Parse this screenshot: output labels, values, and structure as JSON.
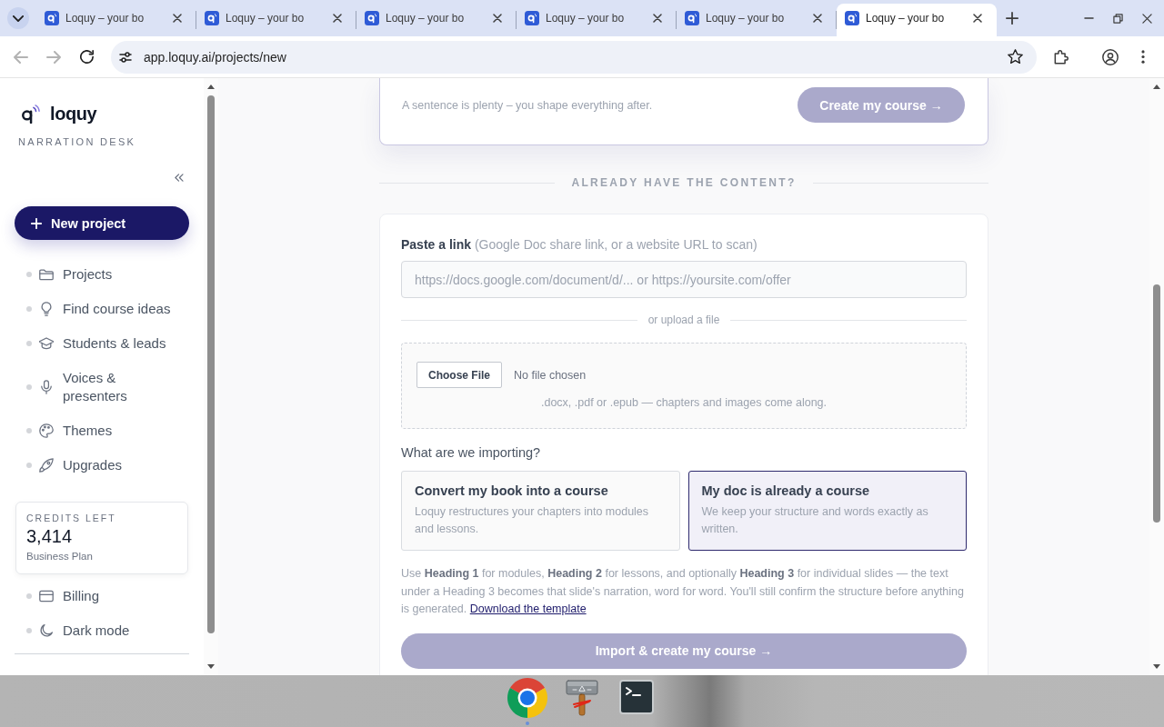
{
  "browser": {
    "tabs": [
      {
        "title": "Loquy – your bo",
        "selected": false
      },
      {
        "title": "Loquy – your bo",
        "selected": false
      },
      {
        "title": "Loquy – your bo",
        "selected": false
      },
      {
        "title": "Loquy – your bo",
        "selected": false
      },
      {
        "title": "Loquy – your bo",
        "selected": false
      },
      {
        "title": "Loquy – your bo",
        "selected": true
      }
    ],
    "back": {
      "disabled": true
    },
    "forward": {
      "disabled": true
    },
    "url": "app.loquy.ai/projects/new"
  },
  "sidebar": {
    "brand": "loquy",
    "tagline": "NARRATION DESK",
    "new_project": "New project",
    "nav": [
      {
        "label": "Projects"
      },
      {
        "label": "Find course ideas"
      },
      {
        "label": "Students & leads"
      },
      {
        "label": "Voices & presenters"
      },
      {
        "label": "Themes"
      },
      {
        "label": "Upgrades"
      }
    ],
    "credits": {
      "label": "CREDITS LEFT",
      "value": "3,414",
      "plan": "Business Plan"
    },
    "footer_nav": [
      {
        "label": "Billing"
      },
      {
        "label": "Dark mode"
      }
    ]
  },
  "main": {
    "prompt_card": {
      "hint": "A sentence is plenty – you shape everything after.",
      "button": {
        "label": "Create my course →",
        "disabled": true
      }
    },
    "section_divider": "ALREADY HAVE THE CONTENT?",
    "import_card": {
      "link_label": "**Paste a link** (Google Doc share link, or a website URL to scan)",
      "link_placeholder": "https://docs.google.com/document/d/... or https://yoursite.com/offer",
      "upload_divider": "or upload a file",
      "file_button": "Choose File",
      "file_status": "No file chosen",
      "file_hint": ".docx, .pdf or .epub — chapters and images come along.",
      "question": "What are we importing?",
      "options": [
        {
          "title": "Convert my book into a course",
          "description": "Loquy restructures your chapters into modules and lessons.",
          "selected": false
        },
        {
          "title": "My doc is already a course",
          "description": "We keep your structure and words exactly as written.",
          "selected": true
        }
      ],
      "help": "Use **Heading 1** for modules, **Heading 2** for lessons, and optionally **Heading 3** for individual slides — the text under a Heading 3 becomes that slide's narration, word for word. You'll still confirm the structure before anything is generated.",
      "help_link": "Download the template",
      "submit": {
        "label": "Import & create my course →",
        "disabled": true
      }
    }
  }
}
